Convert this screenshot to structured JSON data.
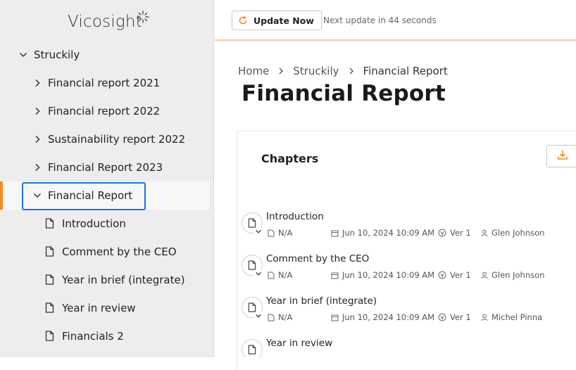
{
  "app": {
    "logo_text": "Vicosight"
  },
  "sidebar": {
    "root": {
      "label": "Struckily"
    },
    "items": [
      {
        "label": "Financial report 2021"
      },
      {
        "label": "Financial report 2022"
      },
      {
        "label": "Sustainability report 2022"
      },
      {
        "label": "Financial Report 2023"
      },
      {
        "label": "Financial Report"
      }
    ],
    "children": [
      {
        "label": "Introduction"
      },
      {
        "label": "Comment by the CEO"
      },
      {
        "label": "Year in brief (integrate)"
      },
      {
        "label": "Year in review"
      },
      {
        "label": "Financials 2"
      }
    ]
  },
  "topbar": {
    "update_label": "Update Now",
    "next_update_text": "Next update in 44 seconds"
  },
  "breadcrumb": {
    "home": "Home",
    "parent": "Struckily",
    "current": "Financial Report"
  },
  "page": {
    "title": "Financial Report"
  },
  "chapters": {
    "title": "Chapters",
    "rows": [
      {
        "name": "Introduction",
        "status": "N/A",
        "date": "Jun 10, 2024 10:09 AM",
        "version": "Ver 1",
        "author": "Glen Johnson"
      },
      {
        "name": "Comment by the CEO",
        "status": "N/A",
        "date": "Jun 10, 2024 10:09 AM",
        "version": "Ver 1",
        "author": "Glen Johnson"
      },
      {
        "name": "Year in brief (integrate)",
        "status": "N/A",
        "date": "Jun 10, 2024 10:09 AM",
        "version": "Ver 1",
        "author": "Michel Pinna"
      },
      {
        "name": "Year in review",
        "status": "",
        "date": "",
        "version": "",
        "author": ""
      }
    ]
  },
  "colors": {
    "accent": "#f08a24",
    "focus": "#1a73e8",
    "sidebar_bg": "#ededed"
  },
  "icons": [
    "chevron-right-icon",
    "chevron-down-icon",
    "document-icon",
    "refresh-icon",
    "download-icon",
    "calendar-icon",
    "version-icon",
    "user-icon"
  ]
}
